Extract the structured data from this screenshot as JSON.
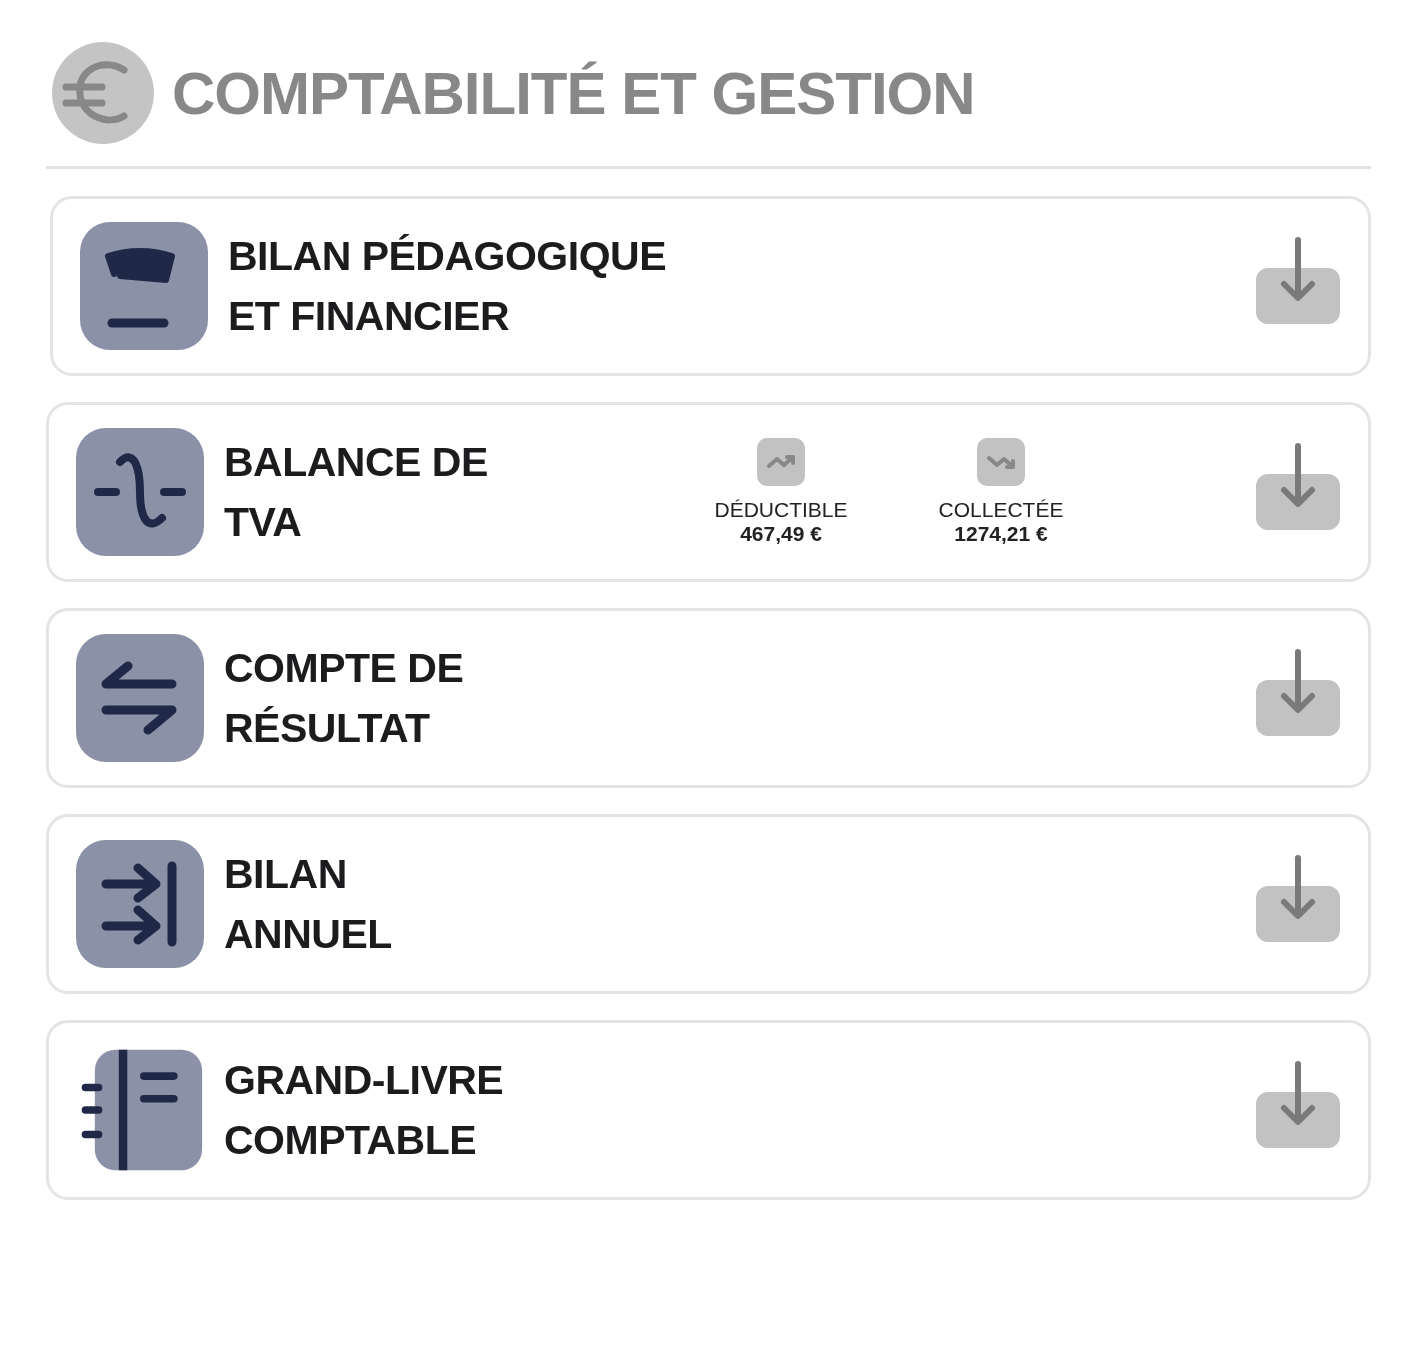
{
  "header": {
    "title": "COMPTABILITÉ ET GESTION"
  },
  "cards": [
    {
      "title_lines": [
        "BILAN PÉDAGOGIQUE",
        "ET FINANCIER"
      ]
    },
    {
      "title_lines": [
        "BALANCE DE",
        "TVA"
      ],
      "stats": [
        {
          "kind": "rise",
          "label": "DÉDUCTIBLE",
          "value": "467,49 €"
        },
        {
          "kind": "fall",
          "label": "COLLECTÉE",
          "value": "1274,21 €"
        }
      ]
    },
    {
      "title_lines": [
        "COMPTE DE",
        "RÉSULTAT"
      ]
    },
    {
      "title_lines": [
        "BILAN",
        "ANNUEL"
      ]
    },
    {
      "title_lines": [
        "GRAND-LIVRE",
        "COMPTABLE"
      ]
    }
  ]
}
